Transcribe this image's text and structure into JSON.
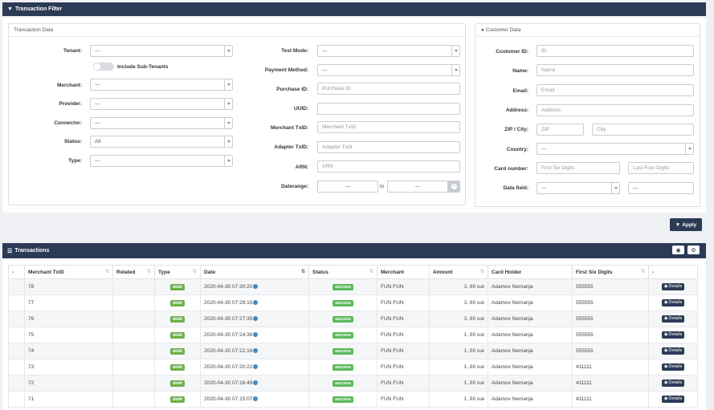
{
  "filter": {
    "title": "Transaction Filter",
    "icon": "filter-icon",
    "transaction_data": {
      "title": "Transaction Data",
      "tenant": {
        "label": "Tenant:",
        "value": "---"
      },
      "include_sub": {
        "label": "Include Sub-Tenants",
        "on": false
      },
      "merchant": {
        "label": "Merchant:",
        "value": "---"
      },
      "provider": {
        "label": "Provider:",
        "value": "---"
      },
      "connector": {
        "label": "Connector:",
        "value": "---"
      },
      "status": {
        "label": "Status:",
        "value": "All"
      },
      "type": {
        "label": "Type:",
        "value": "---"
      },
      "test_mode": {
        "label": "Test Mode:",
        "value": "---"
      },
      "payment_method": {
        "label": "Payment Method:",
        "value": "---"
      },
      "purchase_id": {
        "label": "Purchase ID:",
        "placeholder": "Purchase ID"
      },
      "uuid": {
        "label": "UUID:",
        "placeholder": ""
      },
      "merchant_txid": {
        "label": "Merchant TxID:",
        "placeholder": "Merchant TxID"
      },
      "adapter_txid": {
        "label": "Adapter TxID:",
        "placeholder": "Adapter TxId"
      },
      "arn": {
        "label": "ARN:",
        "placeholder": "ARN"
      },
      "daterange": {
        "label": "Daterange:",
        "from": "---",
        "to_label": "to",
        "to": "---"
      }
    },
    "customer_data": {
      "title": "Customer Data",
      "icon": "user-icon",
      "customer_id": {
        "label": "Customer ID:",
        "placeholder": "ID"
      },
      "name": {
        "label": "Name:",
        "placeholder": "Name"
      },
      "email": {
        "label": "Email:",
        "placeholder": "Email"
      },
      "address": {
        "label": "Address:",
        "placeholder": "Address"
      },
      "zip_city": {
        "label": "ZIP / City:",
        "zip_placeholder": "ZIP",
        "city_placeholder": "City"
      },
      "country": {
        "label": "Country:",
        "value": "---"
      },
      "card_number": {
        "label": "Card number:",
        "first_placeholder": "First Six Digits",
        "last_placeholder": "Last Four Digits"
      },
      "data_field": {
        "label": "Data field:",
        "value": "---",
        "value2": "---"
      }
    },
    "apply_label": "Apply"
  },
  "transactions": {
    "title": "Transactions",
    "icon": "list-icon",
    "columns": [
      "-",
      "Merchant TxID",
      "Related",
      "Type",
      "Date",
      "Status",
      "Merchant",
      "Amount",
      "Card Holder",
      "First Six Digits",
      "-"
    ],
    "details_label": "Details",
    "rows": [
      {
        "txid": "78",
        "type": "debit",
        "date": "2020-04-30 07:30:20",
        "status": "success",
        "merchant": "FUN FUN",
        "amount": "3.00",
        "currency": "EUR",
        "holder": "Adamov Nemanja",
        "first6": "555555"
      },
      {
        "txid": "77",
        "type": "debit",
        "date": "2020-04-30 07:29:15",
        "status": "success",
        "merchant": "FUN FUN",
        "amount": "3.00",
        "currency": "EUR",
        "holder": "Adamov Nemanja",
        "first6": "555555"
      },
      {
        "txid": "76",
        "type": "debit",
        "date": "2020-04-30 07:27:35",
        "status": "success",
        "merchant": "FUN FUN",
        "amount": "3.00",
        "currency": "EUR",
        "holder": "Adamov Nemanja",
        "first6": "555555"
      },
      {
        "txid": "75",
        "type": "debit",
        "date": "2020-04-30 07:24:38",
        "status": "success",
        "merchant": "FUN FUN",
        "amount": "1.00",
        "currency": "EUR",
        "holder": "Adamov Nemanja",
        "first6": "555555"
      },
      {
        "txid": "74",
        "type": "debit",
        "date": "2020-04-30 07:22:16",
        "status": "success",
        "merchant": "FUN FUN",
        "amount": "1.00",
        "currency": "EUR",
        "holder": "Adamov Nemanja",
        "first6": "555555"
      },
      {
        "txid": "73",
        "type": "debit",
        "date": "2020-04-30 07:20:22",
        "status": "success",
        "merchant": "FUN FUN",
        "amount": "1.00",
        "currency": "EUR",
        "holder": "Adamov Nemanja",
        "first6": "411111"
      },
      {
        "txid": "72",
        "type": "debit",
        "date": "2020-04-30 07:16:49",
        "status": "success",
        "merchant": "FUN FUN",
        "amount": "1.00",
        "currency": "EUR",
        "holder": "Adamov Nemanja",
        "first6": "411111"
      },
      {
        "txid": "71",
        "type": "debit",
        "date": "2020-04-30 07:15:07",
        "status": "success",
        "merchant": "FUN FUN",
        "amount": "1.00",
        "currency": "EUR",
        "holder": "Adamov Nemanja",
        "first6": "411111"
      }
    ]
  }
}
